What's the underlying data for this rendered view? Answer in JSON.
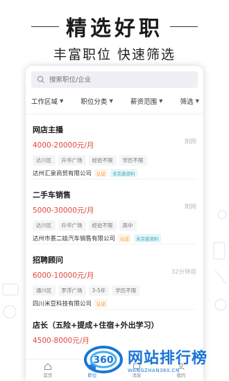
{
  "hero": {
    "title": "精选好职",
    "subtitle": "丰富职位 快速筛选"
  },
  "search": {
    "placeholder": "搜索职位/企业"
  },
  "filters": [
    "工作区域",
    "职位分类",
    "薪资范围",
    "筛选"
  ],
  "jobs": [
    {
      "title": "网店主播",
      "salary": "4000-20000元/月",
      "time": "刚刚",
      "tags": [
        "达川区",
        "升华广场",
        "经验不限",
        "学历不限"
      ],
      "company": "达州汇泉商贸有限公司",
      "verified": "认证",
      "incomplete": "未完善资料"
    },
    {
      "title": "二手车销售",
      "salary": "5000-30000元/月",
      "time": "刚刚",
      "tags": [
        "达川区",
        "升华广场",
        "经验不限",
        "高中"
      ],
      "company": "达州市喜二娃汽车销售有限公司",
      "verified": "认证",
      "incomplete": "未完善资料"
    },
    {
      "title": "招聘顾问",
      "salary": "6000-10000元/月",
      "time": "32分钟前",
      "tags": [
        "通川区",
        "罗浮广场",
        "3-5年",
        "学历不限"
      ],
      "company": "四川米豆科技有限公司",
      "verified": "认证",
      "incomplete": ""
    },
    {
      "title": "店长（五险+提成+住宿+外出学习）",
      "salary": "4500-8000元/月",
      "time": "",
      "tags": [],
      "company": "",
      "verified": "",
      "incomplete": ""
    }
  ],
  "tabbar": [
    "首页",
    "职位",
    "消息",
    "我的"
  ],
  "watermark": {
    "logo": "360",
    "big": "网站排行榜",
    "small": "WANGZHAN360.CN"
  },
  "colors": {
    "salary": "#e0473b",
    "accent": "#2a7de1",
    "watermark": "#1875d8"
  }
}
